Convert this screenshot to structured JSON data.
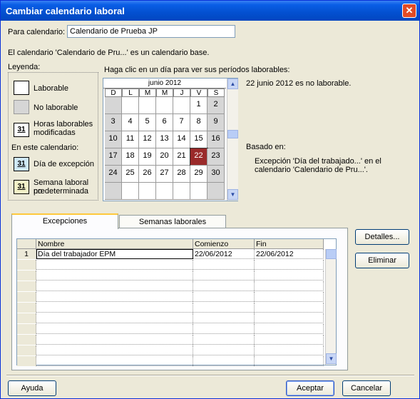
{
  "window": {
    "title": "Cambiar calendario laboral"
  },
  "calendar_field": {
    "label": "Para calendario:",
    "value": "Calendario de Prueba JP"
  },
  "base_note": "El calendario 'Calendario de Pru...' es un calendario base.",
  "legend": {
    "title": "Leyenda:",
    "laborable": "Laborable",
    "no_laborable": "No laborable",
    "horas_mod_1": "Horas laborables",
    "horas_mod_2": "modificadas",
    "en_este": "En este calendario:",
    "excepcion": "Día de excepción",
    "semana_1": "Semana laboral no",
    "semana_2": "predeterminada",
    "swatch_num": "31"
  },
  "calendar": {
    "instruction": "Haga clic en un día para ver sus períodos laborables:",
    "month": "junio 2012",
    "day_headers": [
      "D",
      "L",
      "M",
      "M",
      "J",
      "V",
      "S"
    ],
    "weeks": [
      [
        "",
        "",
        "",
        "",
        "",
        "1",
        "2"
      ],
      [
        "3",
        "4",
        "5",
        "6",
        "7",
        "8",
        "9"
      ],
      [
        "10",
        "11",
        "12",
        "13",
        "14",
        "15",
        "16"
      ],
      [
        "17",
        "18",
        "19",
        "20",
        "21",
        "22",
        "23"
      ],
      [
        "24",
        "25",
        "26",
        "27",
        "28",
        "29",
        "30"
      ],
      [
        "",
        "",
        "",
        "",
        "",
        "",
        ""
      ]
    ],
    "selected_day": "22"
  },
  "info": {
    "status": "22 junio 2012 es no laborable.",
    "basado_label": "Basado en:",
    "basado_line1": "Excepción 'Día del trabajado...' en el",
    "basado_line2": "calendario 'Calendario de Pru...'."
  },
  "tabs": {
    "excepciones": "Excepciones",
    "semanas": "Semanas laborales"
  },
  "table": {
    "headers": [
      "Nombre",
      "Comienzo",
      "Fin"
    ],
    "rows": [
      {
        "num": "1",
        "nombre": "Día del trabajador EPM",
        "comienzo": "22/06/2012",
        "fin": "22/06/2012"
      }
    ]
  },
  "buttons": {
    "detalles": "Detalles...",
    "eliminar": "Eliminar",
    "ayuda": "Ayuda",
    "aceptar": "Aceptar",
    "cancelar": "Cancelar"
  }
}
